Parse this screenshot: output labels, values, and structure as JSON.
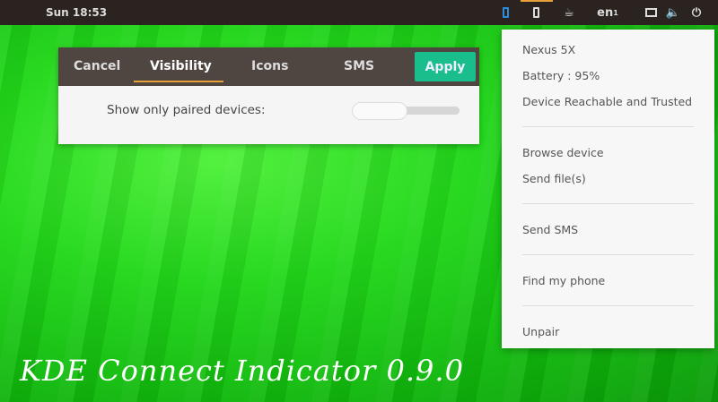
{
  "topbar": {
    "clock": "Sun 18:53",
    "keyboard": "en",
    "keyboard_sub": "1",
    "icons": [
      "kdeconnect-phone-icon",
      "phone-icon",
      "coffee-icon",
      "keyboard-layout-icon",
      "display-icon",
      "volume-icon",
      "power-icon"
    ],
    "accent": "#e8a03a"
  },
  "dialog": {
    "tabs": {
      "cancel": "Cancel",
      "visibility": "Visibility",
      "icons": "Icons",
      "sms": "SMS"
    },
    "apply": "Apply",
    "setting_label": "Show only paired devices:",
    "setting_value": false,
    "apply_color": "#19be8c"
  },
  "menu": {
    "device_name": "Nexus 5X",
    "battery": "Battery : 95%",
    "status": "Device Reachable and Trusted",
    "browse": "Browse device",
    "send_files": "Send file(s)",
    "send_sms": "Send SMS",
    "find_phone": "Find my phone",
    "unpair": "Unpair"
  },
  "overlay_title": "KDE Connect Indicator 0.9.0"
}
